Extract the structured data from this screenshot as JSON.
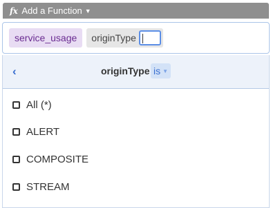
{
  "toolbar": {
    "add_function_label": "Add a Function",
    "fx_icon": "fx"
  },
  "query": {
    "chips": [
      "service_usage",
      "originType"
    ],
    "input_value": ""
  },
  "dropdown": {
    "back_icon": "‹",
    "field": "originType",
    "operator": "is",
    "options": [
      "All (*)",
      "ALERT",
      "COMPOSITE",
      "STREAM"
    ]
  }
}
